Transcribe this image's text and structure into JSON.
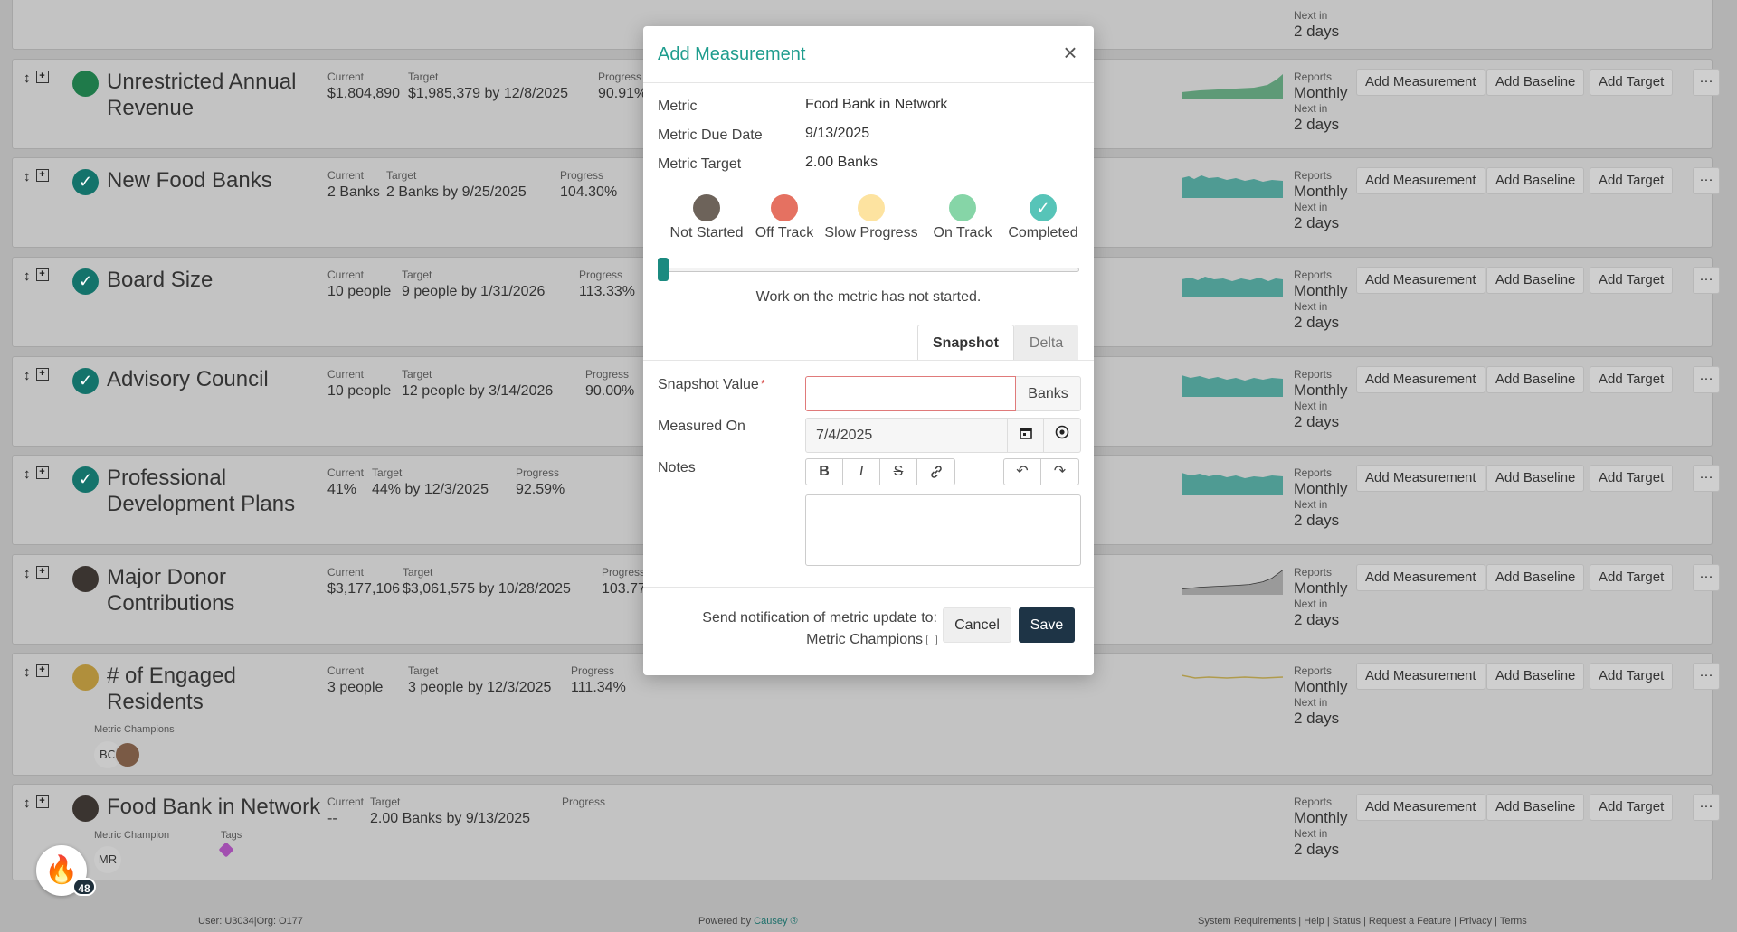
{
  "background": {
    "cards": [
      {
        "title": "Unrestricted Annual Revenue",
        "current": "$1,804,890",
        "target": "$1,985,379 by 12/8/2025",
        "progress": "90.91%",
        "status_color": "#1f7a4a"
      },
      {
        "title": "New Food Banks",
        "current": "2 Banks",
        "target": "2 Banks by 9/25/2025",
        "progress": "104.30%",
        "status_color": "#14736b"
      },
      {
        "title": "Board Size",
        "current": "10 people",
        "target": "9 people by 1/31/2026",
        "progress": "113.33%",
        "status_color": "#14736b"
      },
      {
        "title": "Advisory Council",
        "current": "10 people",
        "target": "12 people by 3/14/2026",
        "progress": "90.00%",
        "status_color": "#14736b"
      },
      {
        "title": "Professional Development Plans",
        "current": "41%",
        "target": "44% by 12/3/2025",
        "progress": "92.59%",
        "status_color": "#14736b"
      },
      {
        "title": "Major Donor Contributions",
        "current": "$3,177,106",
        "target": "$3,061,575 by 10/28/2025",
        "progress": "103.77",
        "status_color": "#3a3430"
      },
      {
        "title": "# of Engaged Residents",
        "current": "3 people",
        "target": "3 people by 12/3/2025",
        "progress": "111.34%",
        "status_color": "#b08f3c"
      },
      {
        "title": "Food Bank in Network",
        "current": "--",
        "target": "2.00 Banks by 9/13/2025",
        "progress": "",
        "status_color": "#3a3430"
      }
    ],
    "labels": {
      "current": "Current",
      "target": "Target",
      "progress": "Progress",
      "reports": "Reports",
      "frequency": "Monthly",
      "next_in": "Next in",
      "next_val": "2 days",
      "metric_champions": "Metric Champions",
      "metric_champion": "Metric Champion",
      "tags": "Tags"
    },
    "buttons": {
      "add_measurement": "Add Measurement",
      "add_baseline": "Add Baseline",
      "add_target": "Add Target",
      "more": "···"
    },
    "top_partial": {
      "next_in": "Next in",
      "next_val": "2 days"
    },
    "avatars": {
      "bc": "BC",
      "mr": "MR"
    },
    "footer": {
      "user": "User: U3034|Org: O177",
      "powered_prefix": "Powered by ",
      "powered_brand": "Causey ®",
      "links": "System Requirements | Help | Status | Request a Feature | Privacy | Terms"
    },
    "fab_badge": "48"
  },
  "modal": {
    "title": "Add Measurement",
    "close": "×",
    "metric_label": "Metric",
    "metric_value": "Food Bank in Network",
    "due_label": "Metric Due Date",
    "due_value": "9/13/2025",
    "target_label": "Metric Target",
    "target_value": "2.00 Banks",
    "statuses": [
      {
        "label": "Not Started",
        "color": "#6d635a"
      },
      {
        "label": "Off Track",
        "color": "#e57161"
      },
      {
        "label": "Slow Progress",
        "color": "#fde3a0"
      },
      {
        "label": "On Track",
        "color": "#86d5a7"
      },
      {
        "label": "Completed",
        "color": "#57c4b8"
      }
    ],
    "slider_description": "Work on the metric has not started.",
    "tabs": {
      "snapshot": "Snapshot",
      "delta": "Delta"
    },
    "snapshot_label": "Snapshot Value",
    "required_mark": "*",
    "snapshot_value": "",
    "unit": "Banks",
    "measured_on_label": "Measured On",
    "measured_on_value": "7/4/2025",
    "notes_label": "Notes",
    "notify_line1": "Send notification of metric update to:",
    "notify_line2": "Metric Champions",
    "cancel": "Cancel",
    "save": "Save"
  }
}
